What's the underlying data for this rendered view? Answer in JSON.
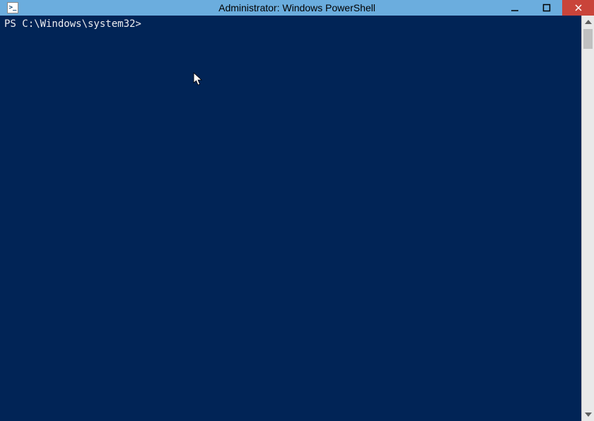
{
  "window": {
    "title": "Administrator: Windows PowerShell",
    "icon_label": "powershell-icon"
  },
  "console": {
    "prompt": "PS C:\\Windows\\system32>"
  },
  "colors": {
    "titlebar": "#6badde",
    "console_bg": "#012456",
    "console_fg": "#eeedf0",
    "close_btn": "#c9443a"
  }
}
